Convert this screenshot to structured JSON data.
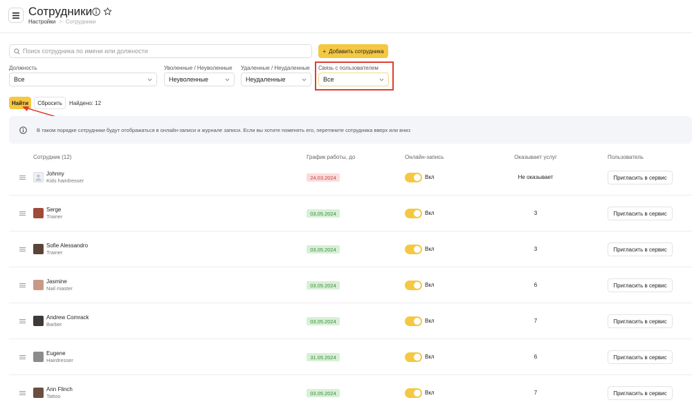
{
  "header": {
    "title": "Сотрудники",
    "breadcrumb": {
      "parent": "Настройки",
      "current": "Сотрудники"
    }
  },
  "toolbar": {
    "search_placeholder": "Поиск сотрудника по имени или должности",
    "add_label": "Добавить сотрудника"
  },
  "filters": [
    {
      "label": "Должность",
      "value": "Все"
    },
    {
      "label": "Уволенные / Неуволенные",
      "value": "Неуволенные"
    },
    {
      "label": "Удаленные / Неудаленные",
      "value": "Неудаленные"
    },
    {
      "label": "Связь с пользователем",
      "value": "Все"
    }
  ],
  "actions": {
    "find_label": "Найти",
    "reset_label": "Сбросить",
    "found_text": "Найдено: 12"
  },
  "notice": "В таком порядке сотрудники будут отображаться в онлайн-записи и журнале записи. Если вы хотите поменять его, перетяните сотрудника вверх или вниз",
  "table": {
    "columns": [
      "Сотрудник (12)",
      "График работы, до",
      "Онлайн-запись",
      "Оказывает услуг",
      "Пользователь"
    ],
    "rows": [
      {
        "name": "Johnny",
        "role": "Kids hairdresser",
        "date": "24.03.2024",
        "date_status": "expired",
        "online": "Вкл",
        "services": "Не оказывает",
        "action": "Пригласить в сервис",
        "avatar": "placeholder"
      },
      {
        "name": "Serge",
        "role": "Trainer",
        "date": "03.05.2024",
        "date_status": "active",
        "online": "Вкл",
        "services": "3",
        "action": "Пригласить в сервис",
        "avatar": "photo"
      },
      {
        "name": "Sofie Alessandro",
        "role": "Trainer",
        "date": "03.05.2024",
        "date_status": "active",
        "online": "Вкл",
        "services": "3",
        "action": "Пригласить в сервис",
        "avatar": "photo"
      },
      {
        "name": "Jasmine",
        "role": "Nail master",
        "date": "03.05.2024",
        "date_status": "active",
        "online": "Вкл",
        "services": "6",
        "action": "Пригласить в сервис",
        "avatar": "photo"
      },
      {
        "name": "Andrew Comrack",
        "role": "Barber",
        "date": "03.05.2024",
        "date_status": "active",
        "online": "Вкл",
        "services": "7",
        "action": "Пригласить в сервис",
        "avatar": "photo"
      },
      {
        "name": "Eugene",
        "role": "Hairdresser",
        "date": "31.05.2024",
        "date_status": "active",
        "online": "Вкл",
        "services": "6",
        "action": "Пригласить в сервис",
        "avatar": "photo"
      },
      {
        "name": "Ann Flinch",
        "role": "Tattoo",
        "date": "03.05.2024",
        "date_status": "active",
        "online": "Вкл",
        "services": "7",
        "action": "Пригласить в сервис",
        "avatar": "photo"
      }
    ]
  },
  "colors": {
    "accent": "#f5c842",
    "highlight": "#e03b2f",
    "date_active_bg": "#d7f0d6",
    "date_expired_bg": "#fbdcdc"
  },
  "icons": [
    "menu-icon",
    "info-icon",
    "star-icon",
    "search-icon",
    "plus-icon",
    "chevron-down-icon",
    "drag-handle-icon",
    "avatar-placeholder-icon"
  ]
}
